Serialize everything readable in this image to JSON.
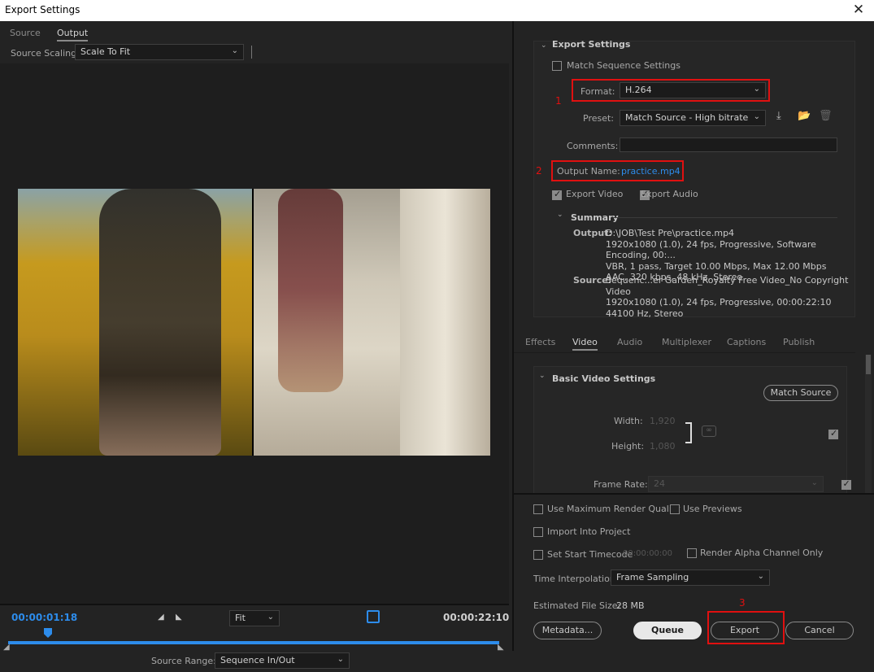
{
  "window": {
    "title": "Export Settings"
  },
  "left": {
    "tabs": [
      {
        "label": "Source"
      },
      {
        "label": "Output"
      }
    ],
    "source_scaling": {
      "label": "Source Scaling:",
      "value": "Scale To Fit"
    },
    "timeline": {
      "current_tc": "00:00:01:18",
      "end_tc": "00:00:22:10",
      "fit": "Fit",
      "source_range_label": "Source Range:",
      "source_range_value": "Sequence In/Out"
    }
  },
  "export_settings": {
    "title": "Export Settings",
    "match_sequence": "Match Sequence Settings",
    "format_label": "Format:",
    "format_value": "H.264",
    "preset_label": "Preset:",
    "preset_value": "Match Source - High bitrate",
    "comments_label": "Comments:",
    "output_name_label": "Output Name:",
    "output_name_value": "practice.mp4",
    "export_video": "Export Video",
    "export_audio": "Export Audio",
    "summary": {
      "title": "Summary",
      "output_label": "Output:",
      "output_lines": [
        "D:\\JOB\\Test Pre\\practice.mp4",
        "1920x1080 (1.0), 24 fps, Progressive, Software Encoding, 00:...",
        "VBR, 1 pass, Target 10.00 Mbps, Max 12.00 Mbps",
        "AAC, 320 kbps, 48 kHz, Stereo"
      ],
      "source_label": "Source:",
      "source_lines": [
        "Sequenc...er Garden_Royalty Free Video_No Copyright Video",
        "1920x1080 (1.0), 24 fps, Progressive, 00:00:22:10",
        "44100 Hz, Stereo"
      ]
    },
    "annotations": [
      "1",
      "2",
      "3"
    ]
  },
  "settings_tabs": [
    {
      "label": "Effects"
    },
    {
      "label": "Video"
    },
    {
      "label": "Audio"
    },
    {
      "label": "Multiplexer"
    },
    {
      "label": "Captions"
    },
    {
      "label": "Publish"
    }
  ],
  "video": {
    "title": "Basic Video Settings",
    "match_source": "Match Source",
    "width_label": "Width:",
    "width_value": "1,920",
    "height_label": "Height:",
    "height_value": "1,080",
    "frame_rate_label": "Frame Rate:",
    "frame_rate_value": "24"
  },
  "bottom": {
    "use_max_render": "Use Maximum Render Quality",
    "use_previews": "Use Previews",
    "import_into_project": "Import Into Project",
    "set_start_tc": "Set Start Timecode",
    "start_tc_value": "00:00:00:00",
    "render_alpha": "Render Alpha Channel Only",
    "time_interp_label": "Time Interpolation:",
    "time_interp_value": "Frame Sampling",
    "est_size_label": "Estimated File Size:",
    "est_size_value": "28 MB",
    "metadata": "Metadata...",
    "queue": "Queue",
    "export": "Export",
    "cancel": "Cancel"
  }
}
